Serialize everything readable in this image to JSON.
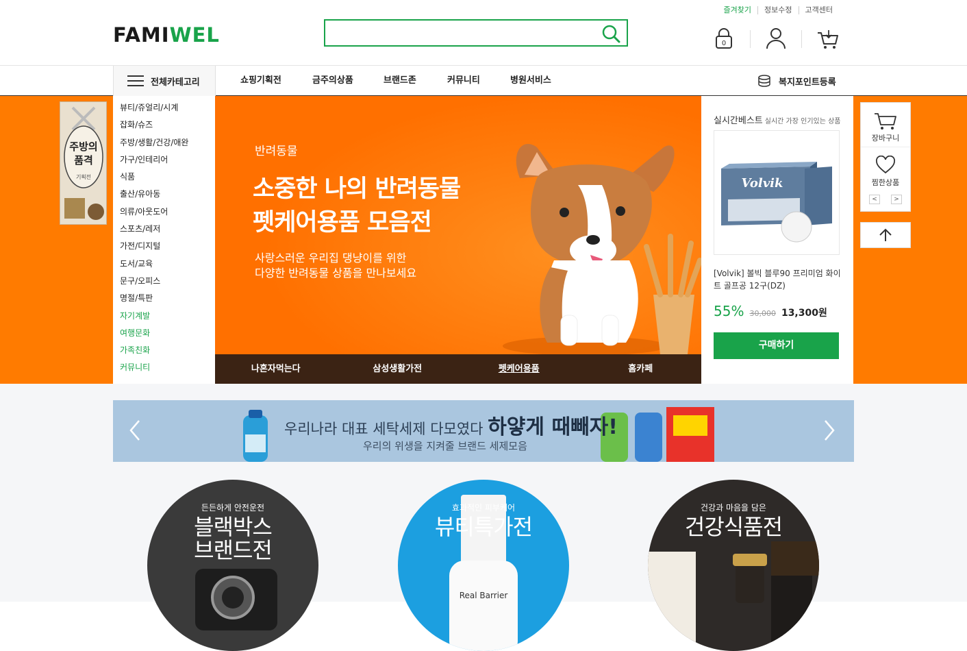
{
  "header": {
    "logo_part1": "FAMI",
    "logo_part2": "WEL",
    "search_placeholder": "",
    "top_links": [
      "즐겨찾기",
      "정보수정",
      "고객센터"
    ],
    "lock_count": "0"
  },
  "nav": {
    "all_category": "전체카테고리",
    "items": [
      "쇼핑기획전",
      "금주의상품",
      "브랜드존",
      "커뮤니티",
      "병원서비스"
    ],
    "point_register": "복지포인트등록"
  },
  "left_ad": {
    "text1": "기획전",
    "text2": "주방의",
    "text3": "품격"
  },
  "category_menu": [
    "뷰티/쥬얼리/시계",
    "잡화/슈즈",
    "주방/생활/건강/애완",
    "가구/인테리어",
    "식품",
    "출산/유아동",
    "의류/아웃도어",
    "스포츠/레저",
    "가전/디지털",
    "도서/교육",
    "문구/오피스",
    "명절/특판",
    "자기계발",
    "여행문화",
    "가족친화",
    "커뮤니티"
  ],
  "banner": {
    "subtitle": "반려동물",
    "title_line1": "소중한 나의 반려동물",
    "title_line2": "펫케어용품 모음전",
    "desc_line1": "사랑스러운 우리집 댕냥이를 위한",
    "desc_line2": "다양한 반려동물 상품을 만나보세요",
    "tabs": [
      "나혼자먹는다",
      "삼성생활가전",
      "펫케어용품",
      "홈카페"
    ],
    "active_tab": 2
  },
  "best": {
    "heading": "실시간베스트",
    "heading_sub": "실시간 가장 인기있는 상품",
    "product_brand": "Volvik",
    "product_name": "[Volvik] 볼빅 블루90 프리미엄 화이트 골프공 12구(DZ)",
    "discount": "55%",
    "old_price": "30,000",
    "price": "13,300원",
    "buy_label": "구매하기"
  },
  "quick": {
    "cart": "장바구니",
    "wish": "찜한상품",
    "prev": "<",
    "next": ">"
  },
  "promo": {
    "line1": "우리나라 대표 세탁세제 다모였다",
    "line1_bold": "하얗게 때빼자!",
    "line2": "우리의 위생을 지켜줄 브랜드 세제모음"
  },
  "circles": [
    {
      "sub": "든든하게 안전운전",
      "title1": "블랙박스",
      "title2": "브랜드전",
      "color": "#3a3a3a"
    },
    {
      "sub": "효과적인 피부케어",
      "title1": "뷰티특가전",
      "title2": "",
      "color": "#1c9fe0"
    },
    {
      "sub": "건강과 마음을 담은",
      "title1": "건강식품전",
      "title2": "",
      "color": "#2e2a28"
    }
  ],
  "colors": {
    "brand_green": "#19a34a",
    "hero_orange": "#ff7b00",
    "tab_bar": "#3b2314"
  }
}
